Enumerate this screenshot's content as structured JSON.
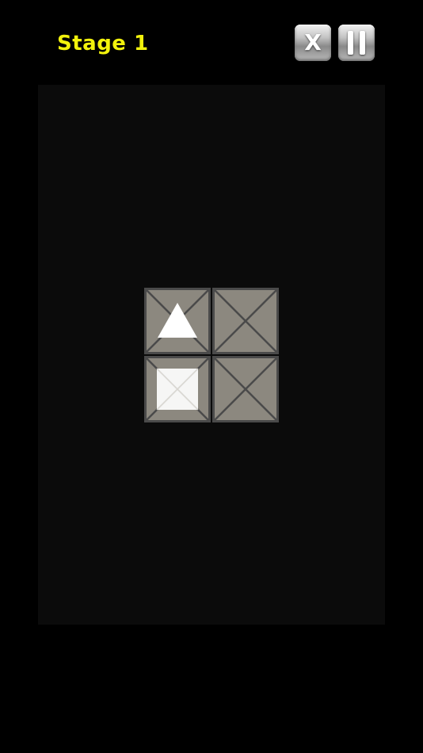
{
  "header": {
    "stage_label": "Stage 1",
    "close_button_glyph": "X",
    "pause_icon": "pause-icon"
  },
  "colors": {
    "background": "#000000",
    "board": "#0b0b0b",
    "stage_text": "#f2f20c",
    "tile_face": "#8c887f",
    "tile_lines": "#4a4a4a",
    "piece": "#ffffff"
  },
  "board": {
    "rows": 2,
    "cols": 2,
    "tiles": [
      {
        "row": 0,
        "col": 0,
        "piece": "triangle"
      },
      {
        "row": 0,
        "col": 1,
        "piece": "none"
      },
      {
        "row": 1,
        "col": 0,
        "piece": "square"
      },
      {
        "row": 1,
        "col": 1,
        "piece": "none"
      }
    ]
  }
}
